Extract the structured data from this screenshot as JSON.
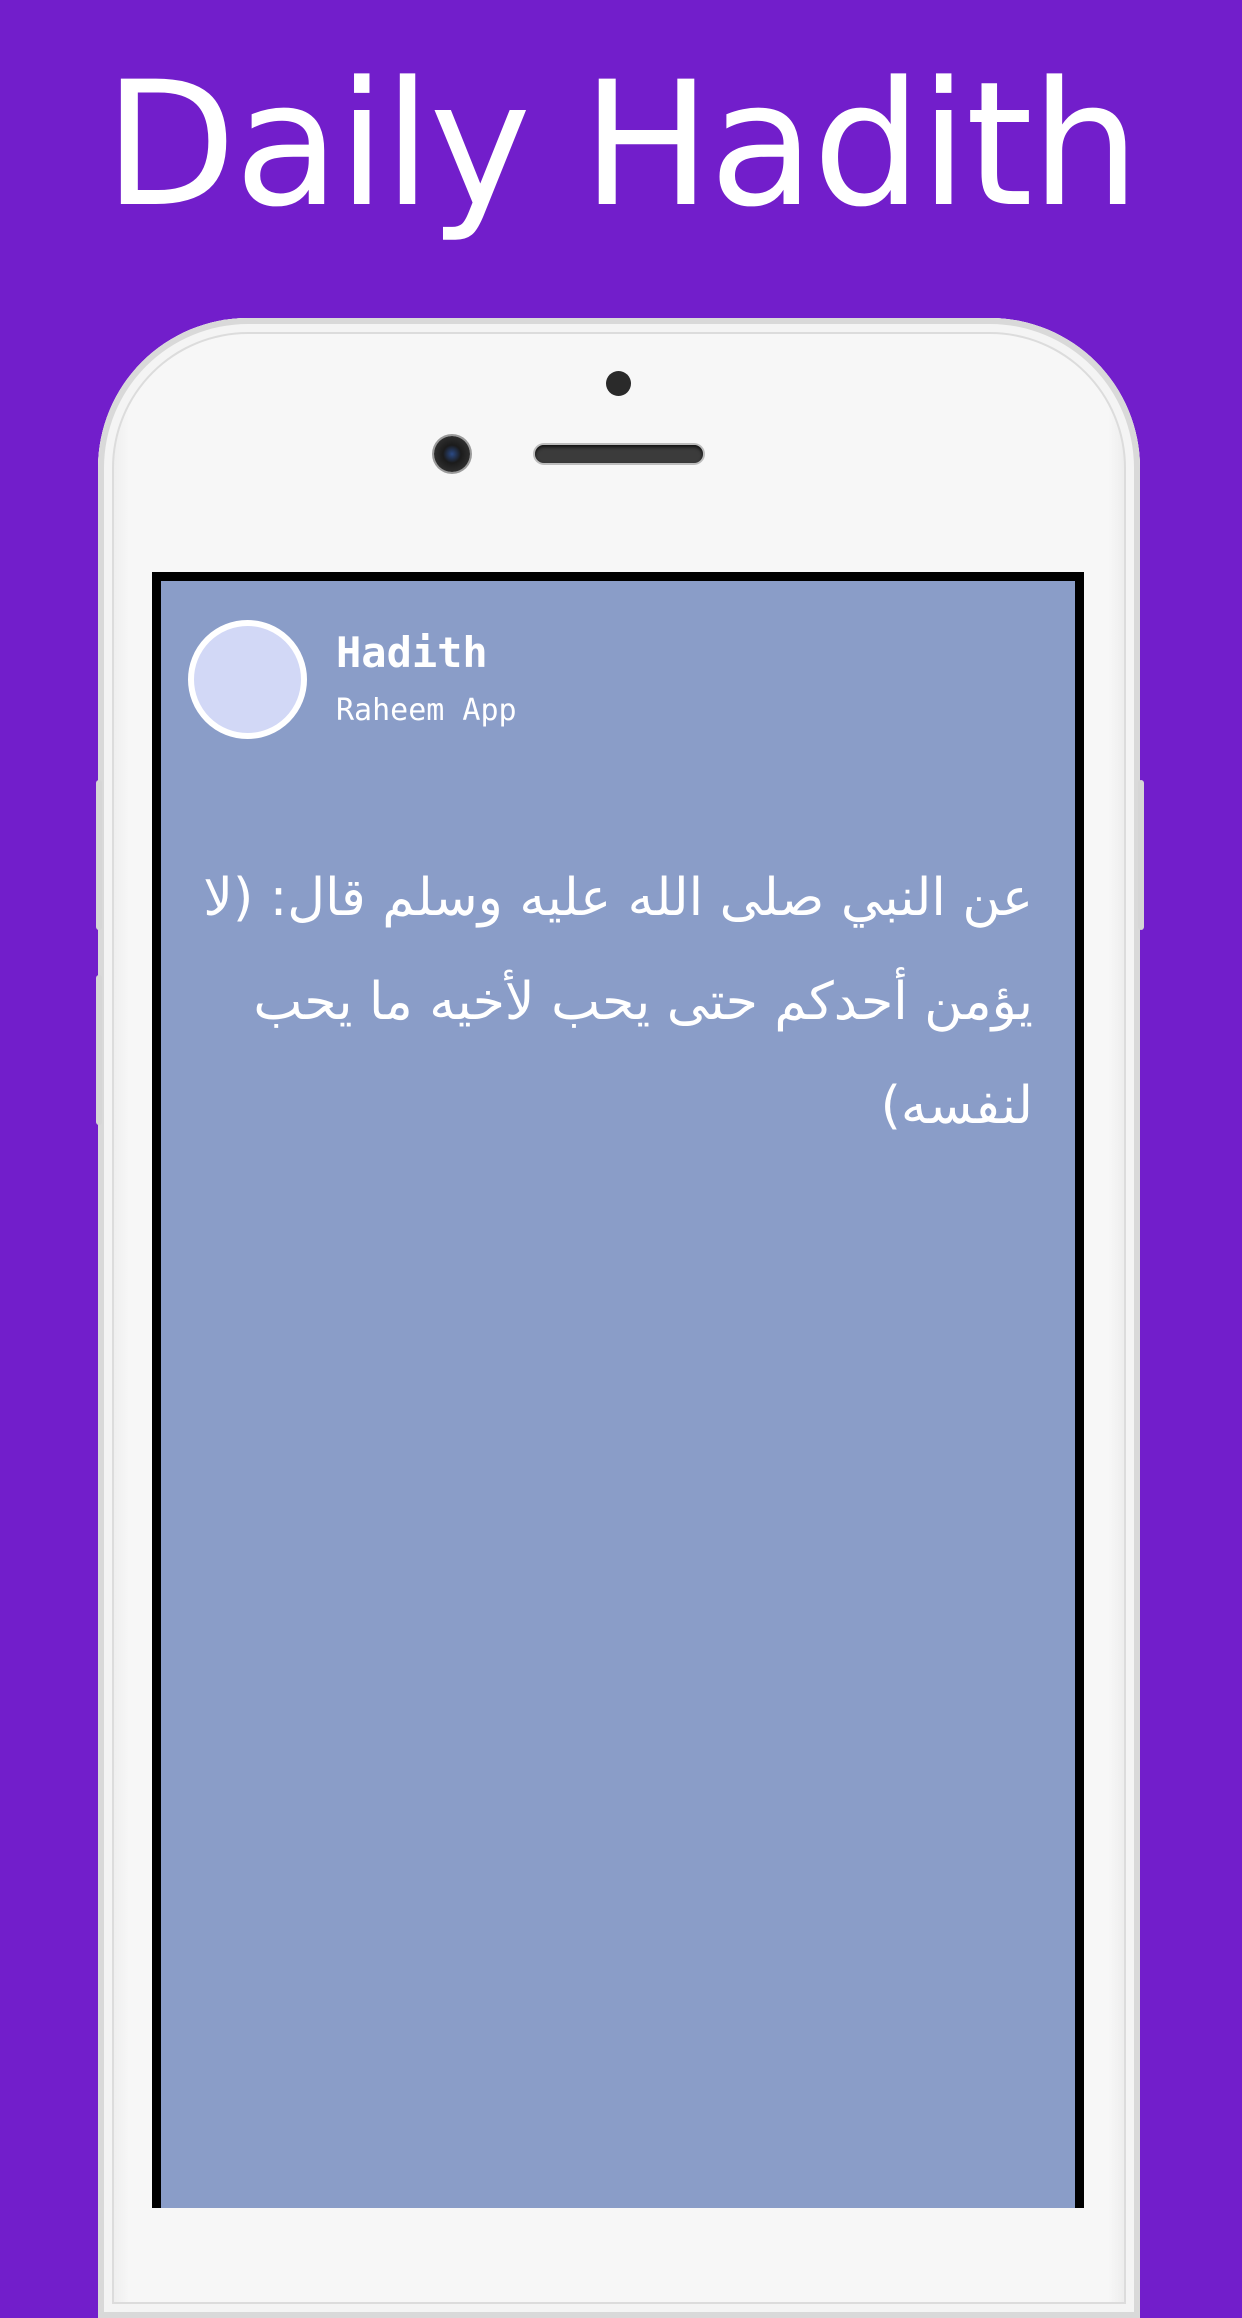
{
  "banner": {
    "headline": "Daily Hadith"
  },
  "card": {
    "title": "Hadith",
    "subtitle": "Raheem App",
    "text": "عن النبي صلى الله عليه وسلم قال: (لا يؤمن أحدكم حتى يحب لأخيه ما يحب لنفسه)"
  },
  "colors": {
    "background": "#721ecb",
    "screen": "#8a9dc8",
    "avatar": "#d2d8f6",
    "phone_body": "#f7f7f7"
  }
}
